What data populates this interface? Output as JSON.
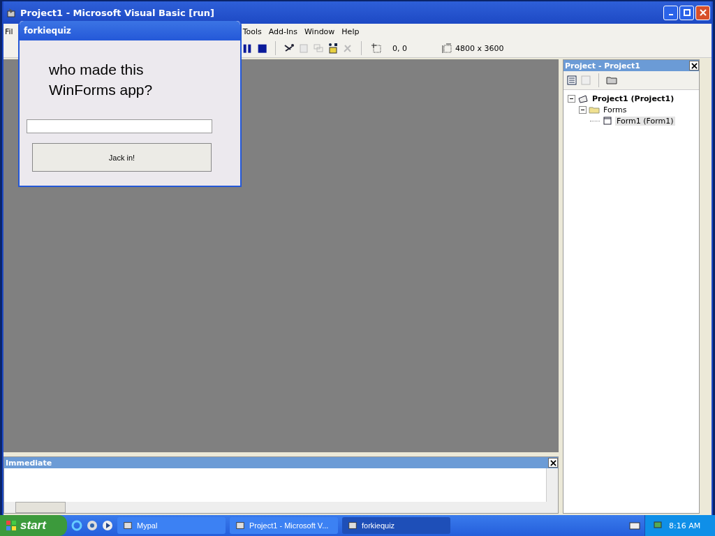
{
  "window": {
    "title": "Project1 - Microsoft Visual Basic [run]"
  },
  "menu": [
    "Fil",
    "Tools",
    "Add-Ins",
    "Window",
    "Help"
  ],
  "toolbar": {
    "position": "0, 0",
    "size": "4800 x 3600"
  },
  "dialog": {
    "title": "forkiequiz",
    "question": "who made this WinForms app?",
    "button": "Jack in!"
  },
  "project_panel": {
    "title": "Project - Project1",
    "tree": [
      {
        "label": "Project1 (Project1)",
        "selected": false,
        "expanded": true,
        "children": [
          {
            "label": "Forms",
            "selected": false,
            "expanded": true,
            "children": [
              {
                "label": "Form1 (Form1)",
                "selected": true
              }
            ]
          }
        ]
      }
    ]
  },
  "immediate": {
    "title": "Immediate"
  },
  "taskbar": {
    "start": "start",
    "tasks": [
      {
        "label": "Mypal",
        "selected": false
      },
      {
        "label": "Project1 - Microsoft V...",
        "selected": false
      },
      {
        "label": "forkiequiz",
        "selected": true
      }
    ],
    "clock": "8:16 AM"
  }
}
